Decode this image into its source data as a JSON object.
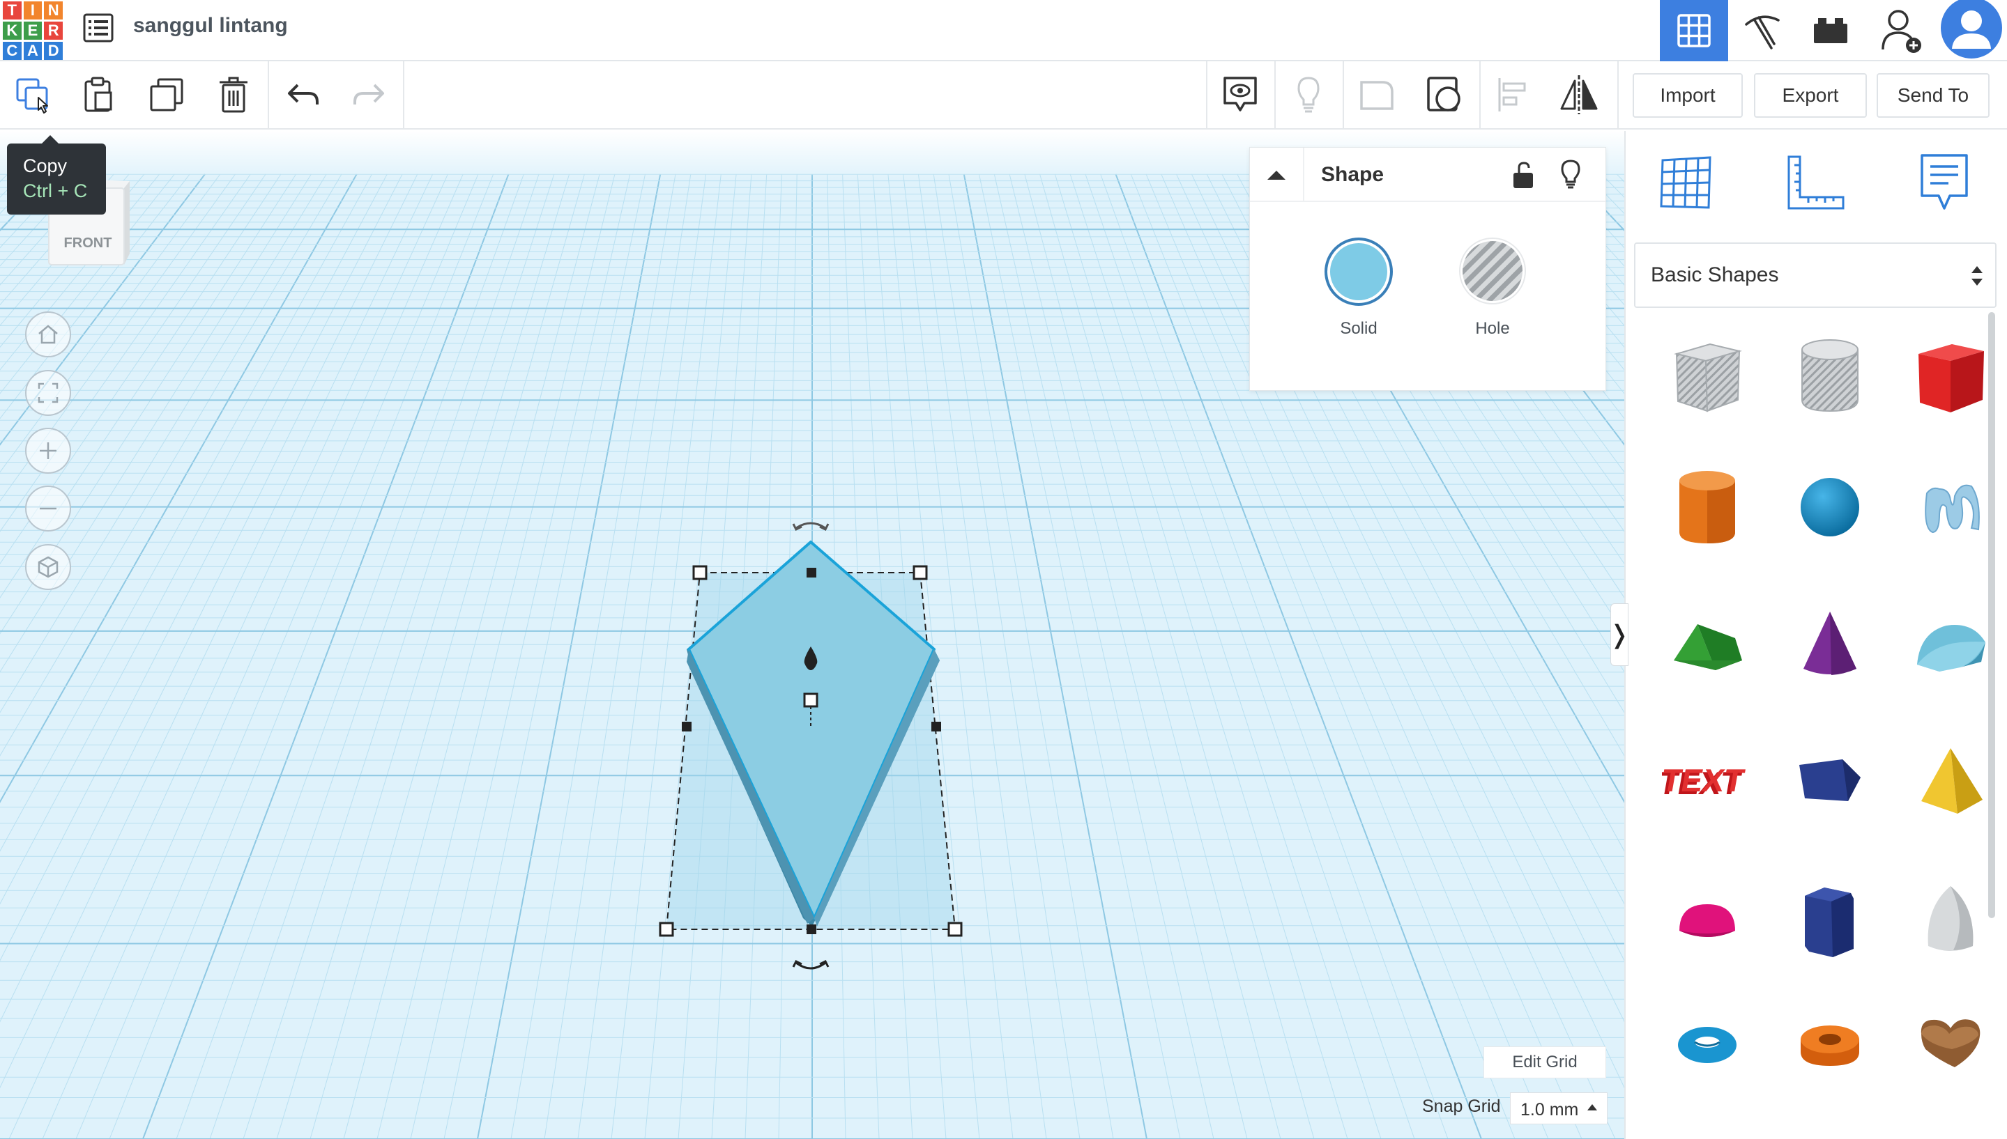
{
  "app": {
    "logo_letters": [
      "T",
      "I",
      "N",
      "K",
      "E",
      "R",
      "C",
      "A",
      "D"
    ],
    "project_title": "sanggul lintang"
  },
  "header_icons": [
    "grid-view-icon",
    "pickaxe-icon",
    "bricks-icon",
    "add-user-icon",
    "avatar-icon"
  ],
  "toolbar": {
    "left_tools": [
      "copy-icon",
      "paste-icon",
      "duplicate-icon",
      "trash-icon",
      "undo-icon",
      "redo-icon"
    ],
    "right_tools": [
      "notes-visibility-icon",
      "lightbulb-icon",
      "group-icon",
      "ungroup-icon",
      "align-icon",
      "mirror-icon"
    ],
    "import_label": "Import",
    "export_label": "Export",
    "send_to_label": "Send To"
  },
  "tooltip": {
    "title": "Copy",
    "shortcut": "Ctrl + C"
  },
  "viewcube": {
    "face_label": "FRONT"
  },
  "nav_controls": [
    "home-view-icon",
    "fit-view-icon",
    "zoom-in-icon",
    "zoom-out-icon",
    "perspective-icon"
  ],
  "inspector": {
    "title": "Shape",
    "solid_label": "Solid",
    "hole_label": "Hole",
    "solid_color": "#7ecbe6"
  },
  "sidepanel": {
    "tools": [
      "workplane-icon",
      "ruler-icon",
      "notes-icon"
    ],
    "category": "Basic Shapes",
    "shapes": [
      "box-hole",
      "cylinder-hole",
      "box",
      "cylinder",
      "sphere",
      "scribble",
      "roof",
      "cone",
      "round-roof",
      "text",
      "polygon",
      "pyramid",
      "half-sphere",
      "prism",
      "paraboloid",
      "torus",
      "tube",
      "heart"
    ]
  },
  "grid_controls": {
    "edit_grid_label": "Edit Grid",
    "snap_grid_label": "Snap Grid",
    "snap_grid_value": "1.0 mm"
  },
  "colors": {
    "accent_blue": "#3d7fe0",
    "workplane": "#dff2fb",
    "selection_outline": "#1aa3d9"
  }
}
